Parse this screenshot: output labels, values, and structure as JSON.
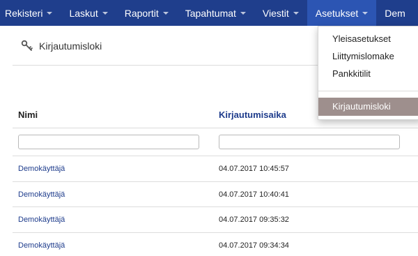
{
  "nav": {
    "items": [
      {
        "label": "Rekisteri"
      },
      {
        "label": "Laskut"
      },
      {
        "label": "Raportit"
      },
      {
        "label": "Tapahtumat"
      },
      {
        "label": "Viestit"
      },
      {
        "label": "Asetukset"
      },
      {
        "label": "Dem"
      }
    ],
    "colors": {
      "bar": "#1f3e8c",
      "active": "#2c55b3"
    }
  },
  "header": {
    "icon": "key-icon",
    "title": "Kirjautumisloki"
  },
  "dropdown": {
    "items": [
      {
        "label": "Yleisasetukset"
      },
      {
        "label": "Liittymislomake"
      },
      {
        "label": "Pankkitilit"
      }
    ],
    "selected": {
      "label": "Kirjautumisloki"
    },
    "colors": {
      "selected_bg": "#9e8f8d"
    }
  },
  "table": {
    "columns": [
      {
        "label": "Nimi"
      },
      {
        "label": "Kirjautumisaika"
      }
    ],
    "filters": [
      {
        "value": "",
        "placeholder": ""
      },
      {
        "value": "",
        "placeholder": ""
      }
    ],
    "rows": [
      {
        "name": "Demokäyttäjä",
        "time": "04.07.2017 10:45:57"
      },
      {
        "name": "Demokäyttäjä",
        "time": "04.07.2017 10:40:41"
      },
      {
        "name": "Demokäyttäjä",
        "time": "04.07.2017 09:35:32"
      },
      {
        "name": "Demokäyttäjä",
        "time": "04.07.2017 09:34:34"
      }
    ]
  }
}
